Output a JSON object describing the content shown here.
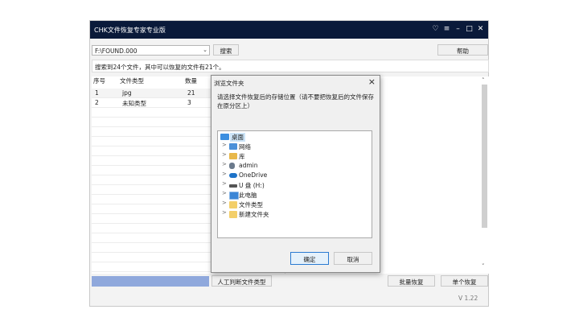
{
  "app": {
    "title": "CHK文件恢复专家专业版",
    "path_value": "F:\\FOUND.000",
    "search_label": "搜索",
    "help_label": "帮助",
    "status": "搜索到24个文件，其中可以恢复的文件有21个。",
    "columns": [
      "序号",
      "文件类型",
      "数量"
    ],
    "rows": [
      {
        "no": "1",
        "type": "jpg",
        "count": "21"
      },
      {
        "no": "2",
        "type": "未知类型",
        "count": "3"
      }
    ],
    "manual_label": "人工判断文件类型",
    "batch_label": "批量恢复",
    "single_label": "单个恢复",
    "version": "V 1.22",
    "colors": {
      "titlebar": "#0a1a3a",
      "progress": "#8fa8dc",
      "accent": "#2a7ad1"
    }
  },
  "dialog": {
    "title": "浏览文件夹",
    "message": "请选择文件恢复后的存储位置（请不要把恢复后的文件保存在原分区上）",
    "tree": [
      {
        "label": "桌面",
        "icon": "desktop-icon",
        "selected": true
      },
      {
        "label": "网络",
        "icon": "network-icon"
      },
      {
        "label": "库",
        "icon": "library-icon"
      },
      {
        "label": "admin",
        "icon": "user-icon"
      },
      {
        "label": "OneDrive",
        "icon": "cloud-icon"
      },
      {
        "label": "U 盘 (H:)",
        "icon": "drive-icon"
      },
      {
        "label": "此电脑",
        "icon": "computer-icon"
      },
      {
        "label": "文件类型",
        "icon": "folder-icon"
      },
      {
        "label": "新建文件夹",
        "icon": "folder-icon"
      }
    ],
    "ok_label": "确定",
    "cancel_label": "取消"
  }
}
